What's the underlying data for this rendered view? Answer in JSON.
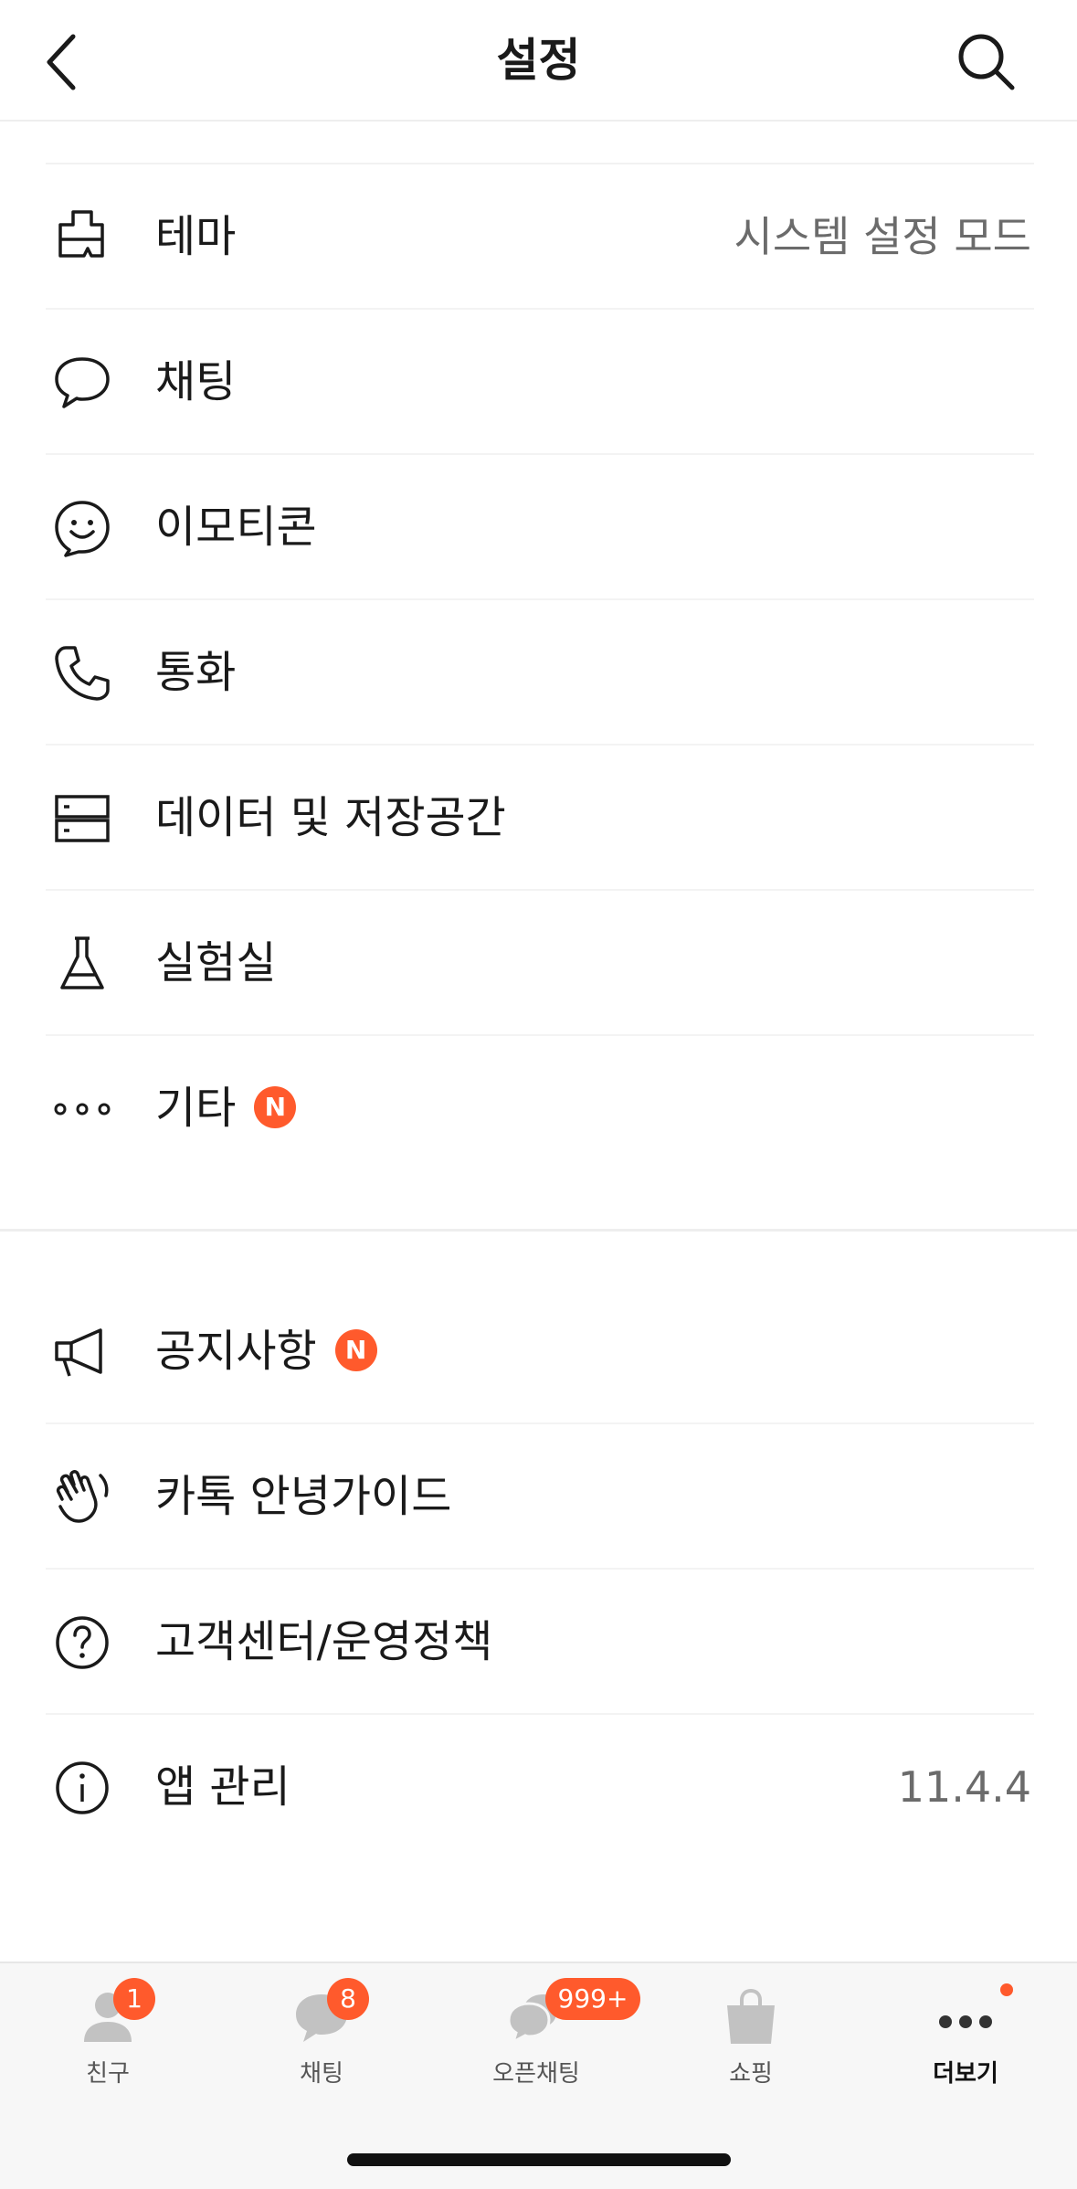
{
  "header": {
    "title": "설정"
  },
  "group1": [
    {
      "label": "테마",
      "value": "시스템 설정 모드",
      "icon": "brush-icon"
    },
    {
      "label": "채팅",
      "icon": "chat-bubble-icon"
    },
    {
      "label": "이모티콘",
      "icon": "emoticon-icon"
    },
    {
      "label": "통화",
      "icon": "phone-icon"
    },
    {
      "label": "데이터 및 저장공간",
      "icon": "storage-icon"
    },
    {
      "label": "실험실",
      "icon": "flask-icon"
    },
    {
      "label": "기타",
      "badge": "N",
      "icon": "more-dots-icon"
    }
  ],
  "group2": [
    {
      "label": "공지사항",
      "badge": "N",
      "icon": "megaphone-icon"
    },
    {
      "label": "카톡 안녕가이드",
      "icon": "waving-hand-icon"
    },
    {
      "label": "고객센터/운영정책",
      "icon": "help-circle-icon"
    },
    {
      "label": "앱 관리",
      "value": "11.4.4",
      "icon": "info-circle-icon"
    }
  ],
  "tabbar": [
    {
      "label": "친구",
      "badge": "1",
      "icon": "friends-icon"
    },
    {
      "label": "채팅",
      "badge": "8",
      "icon": "chats-icon"
    },
    {
      "label": "오픈채팅",
      "badge": "999+",
      "icon": "open-chat-icon"
    },
    {
      "label": "쇼핑",
      "icon": "shopping-bag-icon"
    },
    {
      "label": "더보기",
      "icon": "more-icon",
      "active": true
    }
  ],
  "colors": {
    "badge": "#ff5a2c",
    "text": "#1a1a1a",
    "secondary": "#6b6b6b"
  }
}
